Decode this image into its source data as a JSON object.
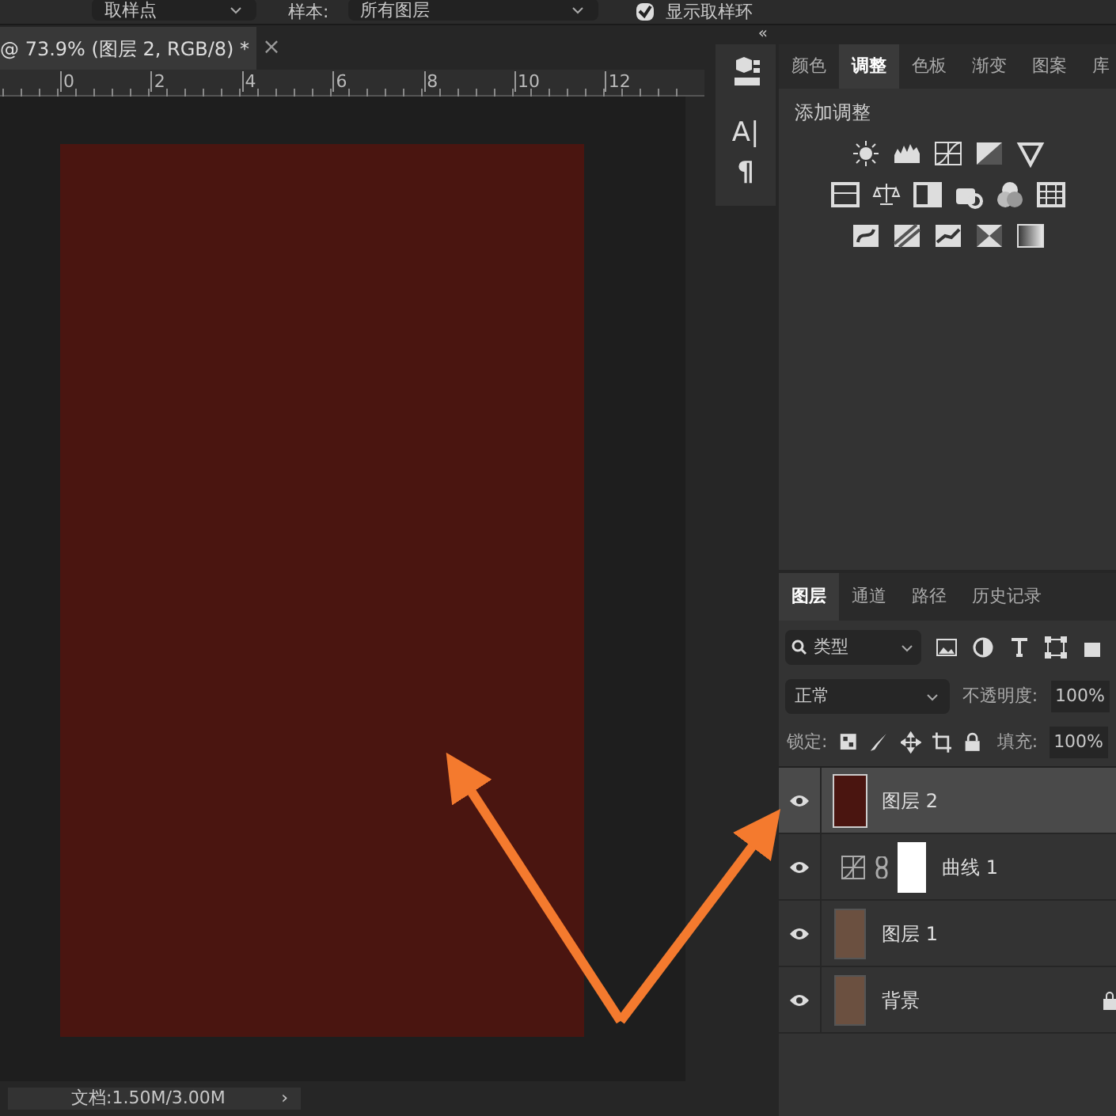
{
  "options_bar": {
    "sample_size": "取样点",
    "sample_label": "样本:",
    "sample": "所有图层",
    "show_ring": {
      "label": "显示取样环",
      "checked": true
    }
  },
  "document_tab": {
    "title": "@ 73.9% (图层 2, RGB/8) *",
    "close": "×"
  },
  "ruler": {
    "ticks": [
      "0",
      "2",
      "4",
      "6",
      "8",
      "10",
      "12"
    ]
  },
  "status_bar": {
    "text": "文档:1.50M/3.00M",
    "arrow": "›"
  },
  "collapse": "«",
  "tool_strip": [
    {
      "kind": "properties"
    },
    {
      "kind": "character",
      "label": "A|"
    },
    {
      "kind": "paragraph",
      "label": "¶"
    }
  ],
  "adjust_panel": {
    "tabs": [
      {
        "label": "颜色",
        "selected": false
      },
      {
        "label": "调整",
        "selected": true
      },
      {
        "label": "色板",
        "selected": false
      },
      {
        "label": "渐变",
        "selected": false
      },
      {
        "label": "图案",
        "selected": false
      },
      {
        "label": "库",
        "selected": false
      }
    ],
    "heading": "添加调整"
  },
  "layers_panel": {
    "tabs": [
      {
        "label": "图层",
        "selected": true
      },
      {
        "label": "通道",
        "selected": false
      },
      {
        "label": "路径",
        "selected": false
      },
      {
        "label": "历史记录",
        "selected": false
      }
    ],
    "filter": "类型",
    "blend_mode": "正常",
    "opacity_label": "不透明度:",
    "opacity": "100%",
    "lock_label": "锁定:",
    "fill_label": "填充:",
    "fill": "100%",
    "layers": [
      {
        "name": "图层 2",
        "kind": "pixel",
        "visible": true,
        "selected": true,
        "locked": false
      },
      {
        "name": "曲线 1",
        "kind": "adjustment",
        "visible": true,
        "selected": false,
        "locked": false
      },
      {
        "name": "图层 1",
        "kind": "photo",
        "visible": true,
        "selected": false,
        "locked": false
      },
      {
        "name": "背景",
        "kind": "photo",
        "visible": true,
        "selected": false,
        "locked": true
      }
    ]
  }
}
